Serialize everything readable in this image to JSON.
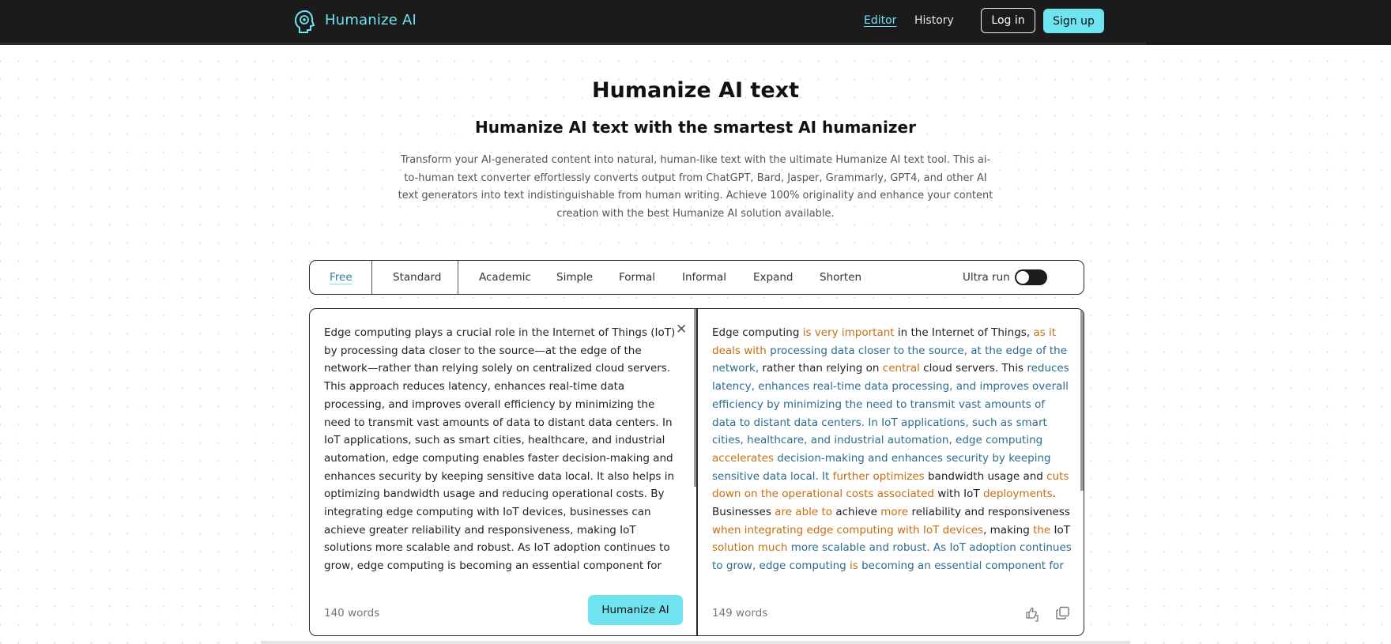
{
  "header": {
    "brand": "Humanize AI",
    "nav": {
      "editor": "Editor",
      "history": "History"
    },
    "login_label": "Log in",
    "signup_label": "Sign up",
    "accent_color": "#6fe3f0",
    "logo_icon": "head-spiral-icon"
  },
  "hero": {
    "title": "Humanize AI text",
    "subtitle": "Humanize AI text with the smartest AI humanizer",
    "description": "Transform your AI-generated content into natural, human-like text with the ultimate Humanize AI text tool. This ai-to-human text converter effortlessly converts output from ChatGPT, Bard, Jasper, Grammarly, GPT4, and other AI text generators into text indistinguishable from human writing. Achieve 100% originality and enhance your content creation with the best Humanize AI solution available."
  },
  "modes": {
    "items": [
      "Free",
      "Standard",
      "Academic",
      "Simple",
      "Formal",
      "Informal",
      "Expand",
      "Shorten"
    ],
    "active": "Free",
    "ultra_label": "Ultra run",
    "ultra_on": false
  },
  "editor": {
    "input_text": "Edge computing plays a crucial role in the Internet of Things (IoT) by processing data closer to the source—at the edge of the network—rather than relying solely on centralized cloud servers. This approach reduces latency, enhances real-time data processing, and improves overall efficiency by minimizing the need to transmit vast amounts of data to distant data centers. In IoT applications, such as smart cities, healthcare, and industrial automation, edge computing enables faster decision-making and enhances security by keeping sensitive data local. It also helps in optimizing bandwidth usage and reducing operational costs. By integrating edge computing with IoT devices, businesses can achieve greater reliability and responsiveness, making IoT solutions more scalable and robust. As IoT adoption continues to grow, edge computing is becoming an essential component for ensuring efficient, low-latency operations and supporting the next generation of smart, connected systems.",
    "input_word_count": "140 words",
    "humanize_label": "Humanize AI",
    "output_segments": [
      {
        "t": "Edge computing ",
        "c": "n"
      },
      {
        "t": "is very important",
        "c": "o"
      },
      {
        "t": " in the Internet of Things, ",
        "c": "n"
      },
      {
        "t": "as it deals with",
        "c": "o"
      },
      {
        "t": " processing data closer to the source, at the edge of the network,",
        "c": "b"
      },
      {
        "t": " rather than relying on ",
        "c": "n"
      },
      {
        "t": "central",
        "c": "o"
      },
      {
        "t": " cloud servers. This ",
        "c": "n"
      },
      {
        "t": "reduces latency, enhances real-time data processing, and improves overall efficiency by minimizing the need to transmit vast amounts of data to distant data centers. In IoT applications, such as smart cities, healthcare, and industrial automation, edge computing",
        "c": "b"
      },
      {
        "t": " accelerates",
        "c": "o"
      },
      {
        "t": " decision-making and enhances security by keeping sensitive data local. It",
        "c": "b"
      },
      {
        "t": " further optimizes",
        "c": "o"
      },
      {
        "t": " bandwidth usage and ",
        "c": "n"
      },
      {
        "t": "cuts down on the operational costs associated",
        "c": "o"
      },
      {
        "t": " with IoT ",
        "c": "n"
      },
      {
        "t": "deployments",
        "c": "o"
      },
      {
        "t": ". Businesses ",
        "c": "n"
      },
      {
        "t": "are able to",
        "c": "o"
      },
      {
        "t": " achieve ",
        "c": "n"
      },
      {
        "t": "more",
        "c": "o"
      },
      {
        "t": " reliability and responsiveness ",
        "c": "n"
      },
      {
        "t": "when integrating edge computing with IoT devices",
        "c": "o"
      },
      {
        "t": ", making ",
        "c": "n"
      },
      {
        "t": "the",
        "c": "o"
      },
      {
        "t": " IoT ",
        "c": "n"
      },
      {
        "t": "solution much",
        "c": "o"
      },
      {
        "t": " more scalable and robust. As IoT adoption continues to grow, edge computing ",
        "c": "b"
      },
      {
        "t": "is",
        "c": "o"
      },
      {
        "t": " becoming an essential component for ensuring efficient, low-latency operations and supporting the next generation of smart, connected systems.",
        "c": "b"
      }
    ],
    "output_word_count": "149 words",
    "highlight_colors": {
      "changed": "#c46f12",
      "kept": "#2c6c8d"
    }
  }
}
